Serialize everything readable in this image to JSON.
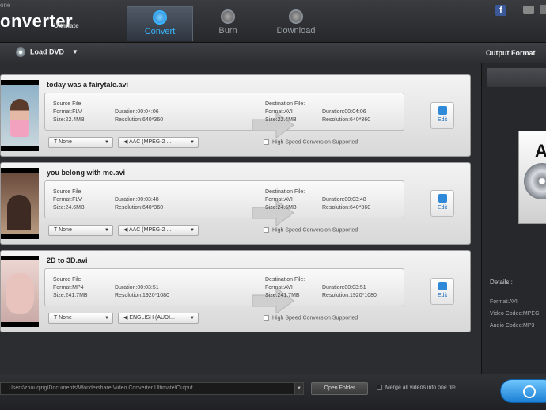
{
  "app": {
    "brand_small": "one",
    "brand": "onverter",
    "brand_sub": "Ultimate"
  },
  "tabs": [
    {
      "label": "Convert",
      "icon": "convert-icon"
    },
    {
      "label": "Burn",
      "icon": "burn-icon"
    },
    {
      "label": "Download",
      "icon": "download-icon"
    }
  ],
  "toolbar": {
    "load_dvd": "Load DVD",
    "output_format": "Output Format"
  },
  "items": [
    {
      "title": "today was a fairytale.avi",
      "src_label": "Source File:",
      "src_format": "Format:FLV",
      "src_size": "Size:22.4MB",
      "src_duration": "Duration:00:04:06",
      "src_resolution": "Resolution:640*360",
      "dst_label": "Destination File:",
      "dst_format": "Format:AVI",
      "dst_size": "Size:22.4MB",
      "dst_duration": "Duration:00:04:06",
      "dst_resolution": "Resolution:640*360",
      "subtitle": "None",
      "audio": "AAC (MPEG-2 ...",
      "edit": "Edit",
      "hs": "High Speed Conversion Supported"
    },
    {
      "title": "you belong with me.avi",
      "src_label": "Source File:",
      "src_format": "Format:FLV",
      "src_size": "Size:24.6MB",
      "src_duration": "Duration:00:03:48",
      "src_resolution": "Resolution:640*360",
      "dst_label": "Destination File:",
      "dst_format": "Format:AVI",
      "dst_size": "Size:24.6MB",
      "dst_duration": "Duration:00:03:48",
      "dst_resolution": "Resolution:640*360",
      "subtitle": "None",
      "audio": "AAC (MPEG-2 ...",
      "edit": "Edit",
      "hs": "High Speed Conversion Supported"
    },
    {
      "title": "2D to 3D.avi",
      "src_label": "Source File:",
      "src_format": "Format:MP4",
      "src_size": "Size:241.7MB",
      "src_duration": "Duration:00:03:51",
      "src_resolution": "Resolution:1920*1080",
      "dst_label": "Destination File:",
      "dst_format": "Format:AVI",
      "dst_size": "Size:241.7MB",
      "dst_duration": "Duration:00:03:51",
      "dst_resolution": "Resolution:1920*1080",
      "subtitle": "None",
      "audio": "ENGLISH (AUDI...",
      "edit": "Edit",
      "hs": "High Speed Conversion Supported"
    }
  ],
  "right_panel": {
    "format_letter": "A",
    "details_title": "Details :",
    "details": [
      "Format:AVI",
      "Video Codec:MPEG",
      "Audio Codec:MP3"
    ]
  },
  "bottom": {
    "path": "...Users\\zhouqing\\Documents\\Wondershare Video Converter Ultimate\\Output",
    "open_folder": "Open Folder",
    "merge": "Merge all videos into one file"
  },
  "colors": {
    "accent": "#39b6ff",
    "bg": "#2b2d31",
    "card": "#e8e8e8"
  }
}
